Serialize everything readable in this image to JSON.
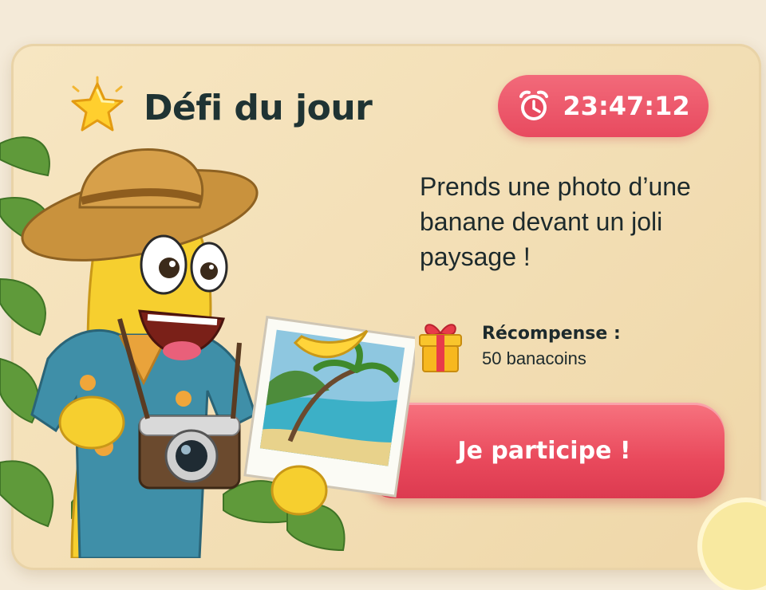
{
  "challenge": {
    "title": "Défi du jour",
    "timer": "23:47:12",
    "description": "Prends une photo d’une banane devant un joli paysage !",
    "reward_label": "Récompense :",
    "reward_value": "50 banacoins",
    "cta_label": "Je participe !"
  },
  "icons": {
    "title_icon": "star-icon",
    "timer_icon": "alarm-clock-icon",
    "reward_icon": "gift-box-icon"
  },
  "colors": {
    "accent": "#e84a5f",
    "card": "#f5e2bb",
    "title_text": "#1f3333"
  }
}
